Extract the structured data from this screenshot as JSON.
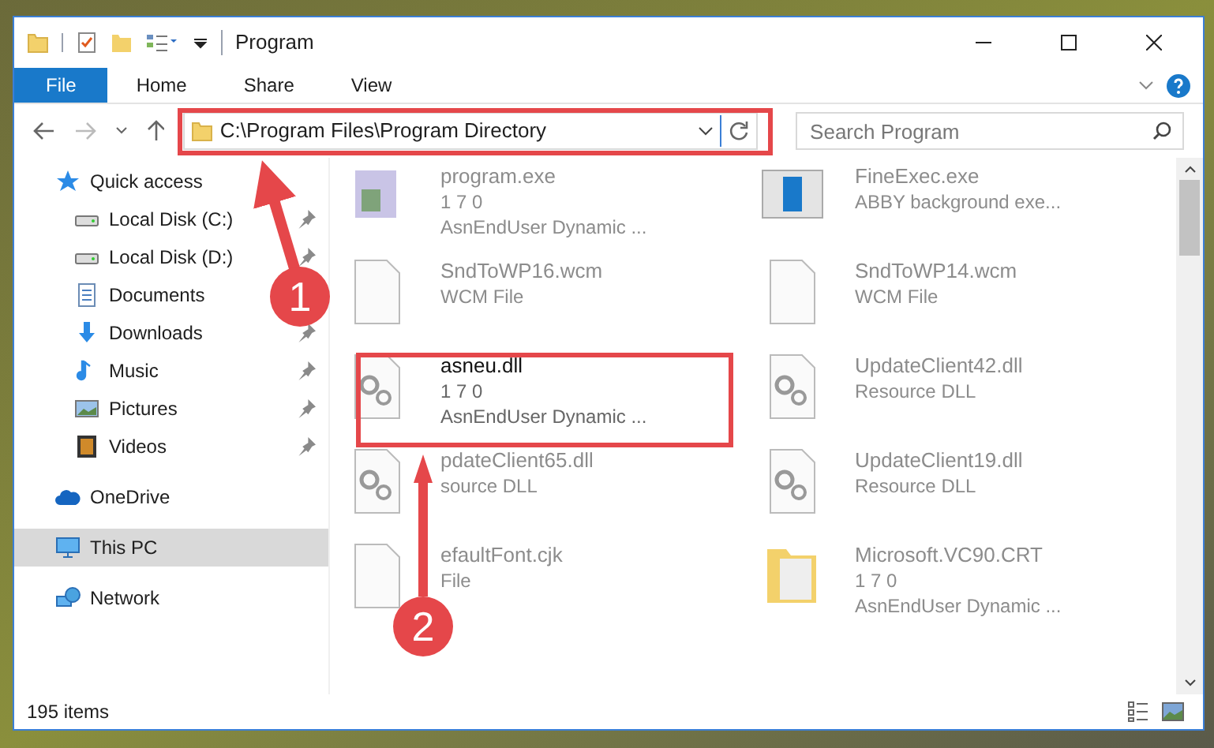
{
  "window": {
    "title": "Program"
  },
  "ribbon_tabs": [
    {
      "label": "File",
      "selected": true
    },
    {
      "label": "Home",
      "selected": false
    },
    {
      "label": "Share",
      "selected": false
    },
    {
      "label": "View",
      "selected": false
    }
  ],
  "address_bar": {
    "path": "C:\\Program Files\\Program Directory"
  },
  "search": {
    "placeholder": "Search Program"
  },
  "sidebar": {
    "items": [
      {
        "label": "Quick access",
        "kind": "star",
        "selected": false,
        "children": [
          {
            "label": "Local Disk (C:)",
            "kind": "drive",
            "pinned": true,
            "selected": false
          },
          {
            "label": "Local Disk (D:)",
            "kind": "drive",
            "pinned": true,
            "selected": false
          },
          {
            "label": "Documents",
            "kind": "documents",
            "selected": false
          },
          {
            "label": "Downloads",
            "kind": "downloads",
            "pinned": true,
            "selected": false
          },
          {
            "label": "Music",
            "kind": "music",
            "pinned": true,
            "selected": false
          },
          {
            "label": "Pictures",
            "kind": "pictures",
            "pinned": true,
            "selected": false
          },
          {
            "label": "Videos",
            "kind": "videos",
            "pinned": true,
            "selected": false
          }
        ]
      },
      {
        "label": "OneDrive",
        "kind": "cloud",
        "selected": false
      },
      {
        "label": "This PC",
        "kind": "pc",
        "selected": true
      },
      {
        "label": "Network",
        "kind": "network",
        "selected": false
      }
    ]
  },
  "files": [
    {
      "name": "program.exe",
      "details": [
        "1 7 0",
        "AsnEndUser Dynamic ..."
      ],
      "kind": "exe",
      "highlighted": false
    },
    {
      "name": "FineExec.exe",
      "details": [
        "ABBY background exe..."
      ],
      "kind": "window",
      "highlighted": false
    },
    {
      "name": "SndToWP16.wcm",
      "details": [
        "WCM File"
      ],
      "kind": "blank",
      "highlighted": false
    },
    {
      "name": "SndToWP14.wcm",
      "details": [
        "WCM File"
      ],
      "kind": "blank",
      "highlighted": false
    },
    {
      "name": "asneu.dll",
      "details": [
        "1 7 0",
        "AsnEndUser Dynamic ..."
      ],
      "kind": "dll",
      "highlighted": true
    },
    {
      "name": "UpdateClient42.dll",
      "details": [
        "Resource DLL"
      ],
      "kind": "dll",
      "highlighted": false
    },
    {
      "name": "pdateClient65.dll",
      "details": [
        "source DLL"
      ],
      "kind": "dll",
      "highlighted": false
    },
    {
      "name": "UpdateClient19.dll",
      "details": [
        "Resource DLL"
      ],
      "kind": "dll",
      "highlighted": false
    },
    {
      "name": "efaultFont.cjk",
      "details": [
        "File"
      ],
      "kind": "blank",
      "highlighted": false
    },
    {
      "name": "Microsoft.VC90.CRT",
      "details": [
        "1 7 0",
        "AsnEndUser Dynamic ..."
      ],
      "kind": "folder",
      "highlighted": false
    }
  ],
  "status_bar": {
    "item_count": "195 items"
  },
  "annotations": [
    {
      "number": "1"
    },
    {
      "number": "2"
    }
  ]
}
